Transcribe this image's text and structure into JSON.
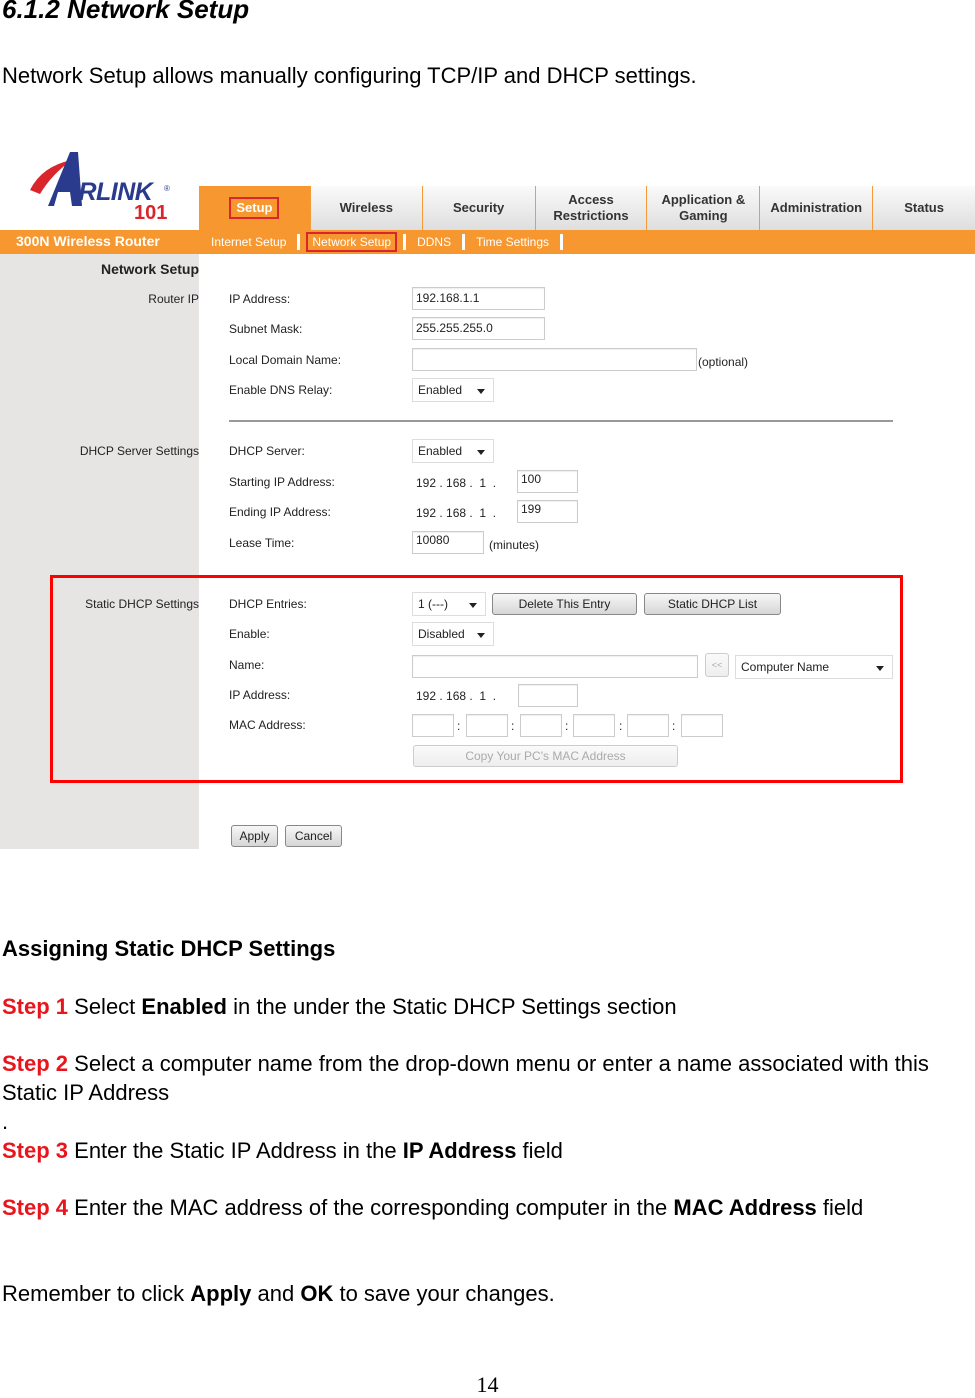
{
  "doc": {
    "title": "6.1.2 Network Setup",
    "intro": "Network Setup allows manually configuring TCP/IP and DHCP settings."
  },
  "router": {
    "logo": {
      "brand": "IRLINK",
      "brand_initial": "A",
      "suffix": "101",
      "reg": "®"
    },
    "product_name": "300N Wireless Router",
    "tabs": [
      {
        "label": "Setup",
        "active": true
      },
      {
        "label": "Wireless"
      },
      {
        "label": "Security"
      },
      {
        "label": "Access Restrictions"
      },
      {
        "label": "Application & Gaming"
      },
      {
        "label": "Administration"
      },
      {
        "label": "Status"
      }
    ],
    "subnav": [
      {
        "label": "Internet Setup"
      },
      {
        "label": "Network Setup",
        "active": true
      },
      {
        "label": "DDNS"
      },
      {
        "label": "Time Settings"
      }
    ],
    "sections": {
      "page_heading": "Network Setup",
      "router_ip": "Router IP",
      "dhcp_server": "DHCP Server Settings",
      "static_dhcp": "Static DHCP Settings"
    },
    "router_ip": {
      "ip_label": "IP Address:",
      "ip_value": "192.168.1.1",
      "mask_label": "Subnet Mask:",
      "mask_value": "255.255.255.0",
      "domain_label": "Local Domain Name:",
      "domain_value": "",
      "domain_hint": "(optional)",
      "dns_relay_label": "Enable DNS Relay:",
      "dns_relay_value": "Enabled"
    },
    "dhcp": {
      "server_label": "DHCP Server:",
      "server_value": "Enabled",
      "start_label": "Starting IP Address:",
      "start_prefix": "192 . 168 .  1  .",
      "start_value": "100",
      "end_label": "Ending IP Address:",
      "end_prefix": "192 . 168 .  1  .",
      "end_value": "199",
      "lease_label": "Lease Time:",
      "lease_value": "10080",
      "lease_unit": "(minutes)"
    },
    "static": {
      "entries_label": "DHCP Entries:",
      "entries_value": "1 (---)",
      "delete_button": "Delete This Entry",
      "list_button": "Static DHCP List",
      "enable_label": "Enable:",
      "enable_value": "Disabled",
      "name_label": "Name:",
      "name_value": "",
      "copy_name_button": "<<",
      "computer_select": "Computer Name",
      "ip_label": "IP Address:",
      "ip_prefix": "192 . 168 .  1  .",
      "ip_value": "",
      "mac_label": "MAC Address:",
      "mac_values": [
        "",
        "",
        "",
        "",
        "",
        ""
      ],
      "mac_sep": ":",
      "copy_mac_button": "Copy Your PC's MAC Address"
    },
    "actions": {
      "apply": "Apply",
      "cancel": "Cancel"
    }
  },
  "instructions": {
    "title": "Assigning Static DHCP Settings",
    "step1": {
      "label": "Step 1",
      "pre": " Select ",
      "bold": "Enabled",
      "post": " in the under the Static DHCP Settings section"
    },
    "step2": {
      "label": "Step 2",
      "text": " Select a computer name from the drop-down menu or enter a name associated with this Static IP Address",
      "trail": "."
    },
    "step3": {
      "label": "Step 3",
      "pre": " Enter the Static IP Address in the ",
      "bold": "IP Address",
      "post": " field"
    },
    "step4": {
      "label": "Step 4",
      "pre": " Enter the MAC address of the corresponding computer in the ",
      "bold": "MAC Address",
      "post": " field"
    },
    "reminder": {
      "pre": "Remember to click ",
      "bold1": "Apply",
      "mid": " and ",
      "bold2": "OK",
      "post": " to save your changes."
    }
  },
  "page_number": "14"
}
